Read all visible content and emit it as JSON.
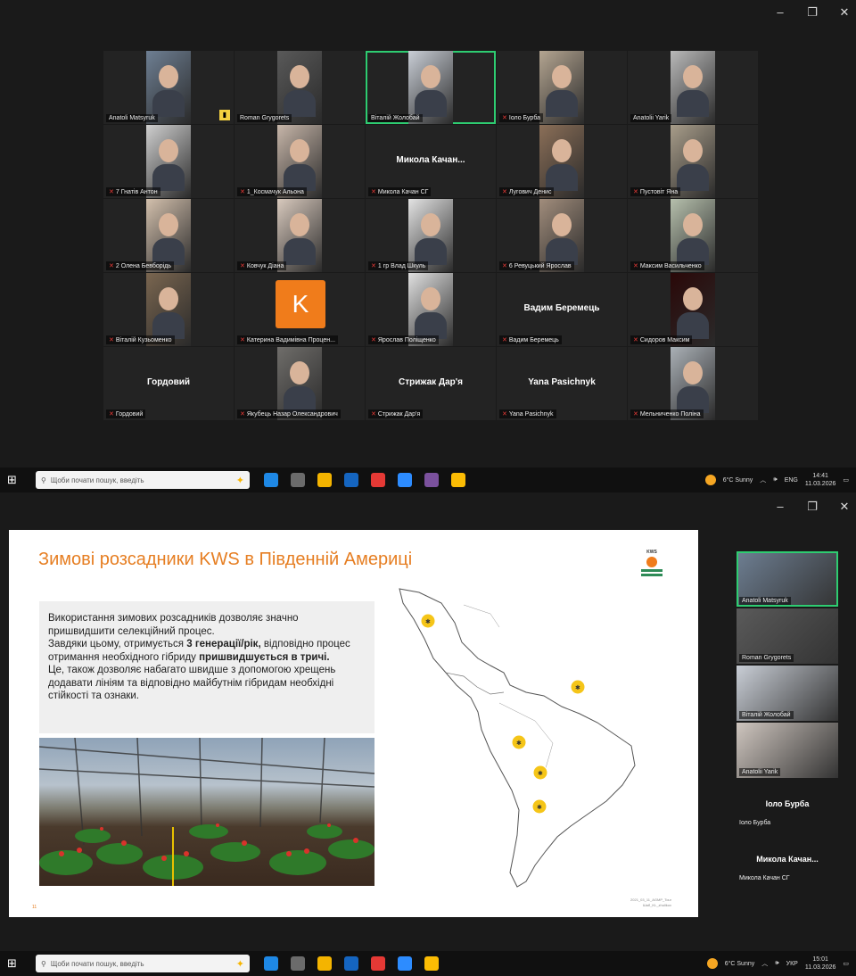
{
  "top_window": {
    "controls": [
      "–",
      "❐",
      "✕"
    ],
    "tiles": [
      {
        "label": "Anatoli Matsyruk",
        "kind": "video",
        "bg": "#6e7f93",
        "active": false,
        "muted": false,
        "pin": true
      },
      {
        "label": "Roman Grygorets",
        "kind": "video",
        "bg": "#595959",
        "active": false,
        "muted": false
      },
      {
        "label": "Віталій Жолобай",
        "kind": "video",
        "bg": "#c9ced6",
        "active": true,
        "muted": false
      },
      {
        "label": "Іоло Бурба",
        "kind": "video",
        "bg": "#b4a591",
        "active": false,
        "muted": true
      },
      {
        "label": "Anatolii Yarik",
        "kind": "video",
        "bg": "#b9b9b9",
        "active": false,
        "muted": false
      },
      {
        "label": "7 Гнатів Антон",
        "kind": "video",
        "bg": "#cfcfcf",
        "active": false,
        "muted": true
      },
      {
        "label": "1_Космачук Альона",
        "kind": "video",
        "bg": "#c7b6a9",
        "active": false,
        "muted": true
      },
      {
        "label": "Микола Качан СГ",
        "kind": "name",
        "bigname": "Микола Качан...",
        "active": false,
        "muted": true
      },
      {
        "label": "Лугович Денис",
        "kind": "video",
        "bg": "#8b6f58",
        "active": false,
        "muted": true
      },
      {
        "label": "Пустовіт Яна",
        "kind": "video",
        "bg": "#a89d8a",
        "active": false,
        "muted": true
      },
      {
        "label": "2 Олена Бевборідь",
        "kind": "video",
        "bg": "#d3c0ad",
        "active": false,
        "muted": true
      },
      {
        "label": "Ковчук Діана",
        "kind": "video",
        "bg": "#d8c9bd",
        "active": false,
        "muted": true
      },
      {
        "label": "1 гр Влад Шкуль",
        "kind": "video",
        "bg": "#e3e3e3",
        "active": false,
        "muted": true
      },
      {
        "label": "6 Ревуцький Ярослав",
        "kind": "video",
        "bg": "#a18d7c",
        "active": false,
        "muted": true
      },
      {
        "label": "Максим Васильченко",
        "kind": "video",
        "bg": "#b6c0ad",
        "active": false,
        "muted": true
      },
      {
        "label": "Віталій Кузьоменко",
        "kind": "video",
        "bg": "#7a6650",
        "active": false,
        "muted": true
      },
      {
        "label": "Катерина Вадимівна Процен...",
        "kind": "avatar",
        "avatar_letter": "K",
        "active": false,
        "muted": true
      },
      {
        "label": "Ярослав Поліщенко",
        "kind": "video",
        "bg": "#e0e0e0",
        "active": false,
        "muted": true
      },
      {
        "label": "Вадим Беремець",
        "kind": "name",
        "bigname": "Вадим Беремець",
        "active": false,
        "muted": true
      },
      {
        "label": "Сидоров Максим",
        "kind": "video",
        "bg": "#2a0808",
        "active": false,
        "muted": true
      },
      {
        "label": "Гордовий",
        "kind": "name",
        "bigname": "Гордовий",
        "active": false,
        "muted": true
      },
      {
        "label": "Якубець Назар Олександрович",
        "kind": "video",
        "bg": "#6f6d6a",
        "active": false,
        "muted": true
      },
      {
        "label": "Стрижак Дар'я",
        "kind": "name",
        "bigname": "Стрижак Дар'я",
        "active": false,
        "muted": true
      },
      {
        "label": "Yana Pasichnyk",
        "kind": "name",
        "bigname": "Yana Pasichnyk",
        "active": false,
        "muted": true
      },
      {
        "label": "Мельниченко Поліна",
        "kind": "video",
        "bg": "#aab0b6",
        "active": false,
        "muted": true
      }
    ]
  },
  "taskbar": {
    "start_icon": "⊞",
    "search_placeholder": "Щоби почати пошук, введіть",
    "apps": [
      {
        "name": "edge",
        "color": "#1e88e5"
      },
      {
        "name": "file-explorer-calc",
        "color": "#6b6b6b"
      },
      {
        "name": "folder",
        "color": "#f4b400"
      },
      {
        "name": "store",
        "color": "#1565c0"
      },
      {
        "name": "chrome",
        "color": "#e53935"
      },
      {
        "name": "zoom",
        "color": "#2d8cff"
      },
      {
        "name": "viber",
        "color": "#7b519d"
      },
      {
        "name": "chrome-profile",
        "color": "#fbbc04"
      }
    ],
    "weather": "6°C Sunny",
    "lang_top": "ENG",
    "lang_bottom": "УКР",
    "time_top": "14:41",
    "time_bottom": "15:01",
    "date": "11.03.2026"
  },
  "slide": {
    "title": "Зимові розсадники KWS в Південній Америці",
    "logo_text": "KWS",
    "paragraph_1": "Використання зимових розсадників дозволяє значно пришвидшити селекційний процес.",
    "paragraph_2_prefix": "Завдяки цьому, отримується ",
    "paragraph_2_bold": "3 генерації/рік,",
    "paragraph_2_suffix": " відповідно процес отримання необхідного гібриду ",
    "paragraph_2_bold2": "пришвидшується в тричі.",
    "paragraph_3": "Це, також дозволяє набагато швидше з допомогою хрещень додавати лініям та відповідно майбутнім гібридам необхідні стійкості та ознаки.",
    "footer_line1": "2021_03_11_AGMP_Tour",
    "footer_line2": "Шаб_KL_zhulikov",
    "page_number": "11"
  },
  "side_panel": {
    "tiles": [
      {
        "label": "Anatoli Matsyruk",
        "bg": "#6e7f93",
        "active": true
      },
      {
        "label": "Roman Grygorets",
        "bg": "#5a5a5a",
        "active": false
      },
      {
        "label": "Віталій Жолобай",
        "bg": "#c9ced6",
        "active": false
      },
      {
        "label": "Anatolii Yarik",
        "bg": "#cfc6bf",
        "active": false
      }
    ],
    "names": [
      {
        "bigname": "Іоло Бурба",
        "label": "Іоло Бурба"
      },
      {
        "bigname": "Микола Качан...",
        "label": "Микола Качан СГ"
      }
    ]
  }
}
